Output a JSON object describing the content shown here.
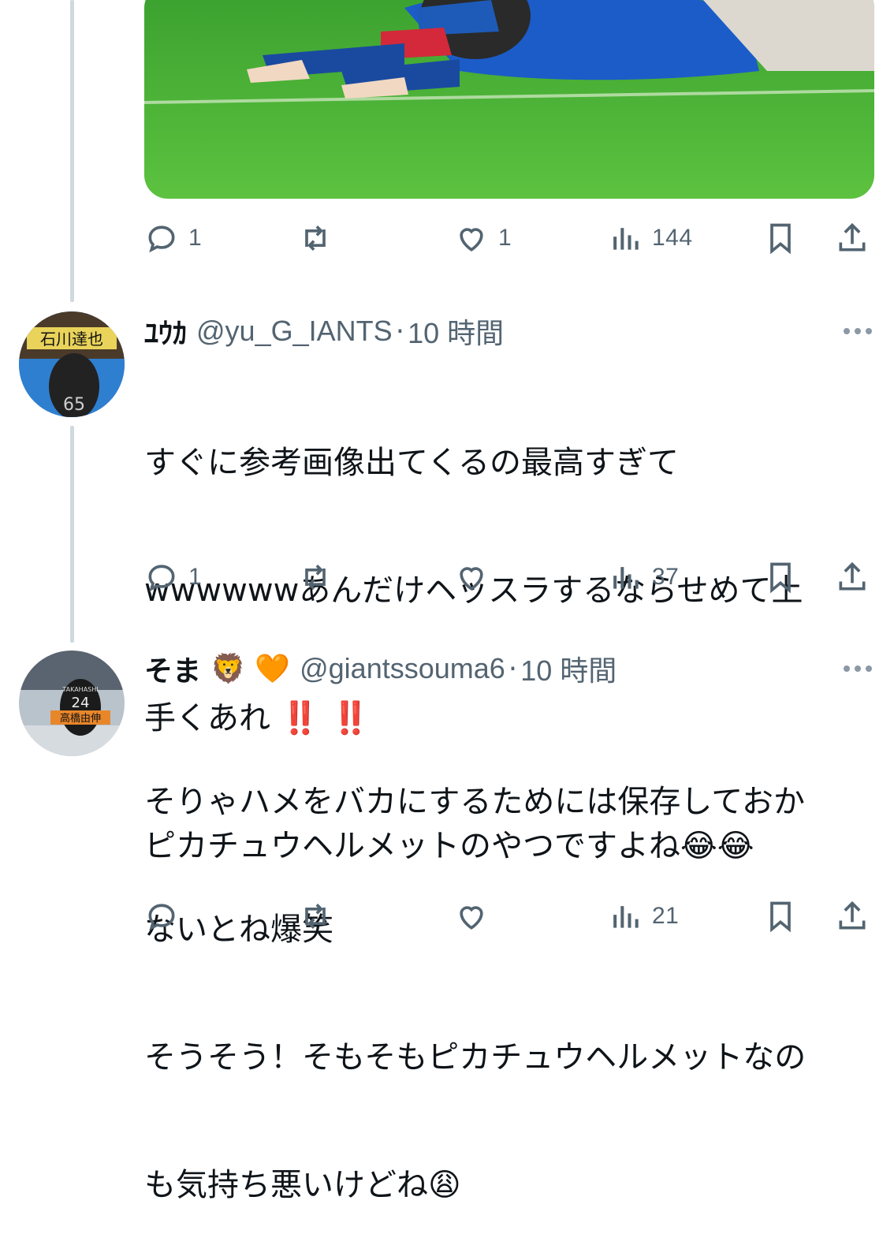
{
  "top_tweet": {
    "actions": {
      "replies": "1",
      "retweets": "",
      "likes": "1",
      "views": "144"
    }
  },
  "tweets": [
    {
      "name": "ﾕｳｶ",
      "handle": "@yu_G_IANTS",
      "separator": "·",
      "time": "10 時間",
      "text_line1": "すぐに参考画像出てくるの最高すぎて",
      "text_line2": "wwwwwwあんだけヘッスラするならせめて上",
      "text_line3": "手くあれ",
      "text_line3_emoji": "‼️ ‼️",
      "text_line4": "ピカチュウヘルメットのやつですよね",
      "text_line4_emoji": "😂😂",
      "avatar_text": "石川達也",
      "avatar_number": "65",
      "actions": {
        "replies": "1",
        "retweets": "",
        "likes": "",
        "views": "37"
      }
    },
    {
      "name": "そま",
      "name_emoji": "🦁 🧡",
      "handle": "@giantssouma6",
      "separator": "·",
      "time": "10 時間",
      "text_line1": "そりゃハメをバカにするためには保存しておか",
      "text_line2": "ないとね爆笑",
      "text_line3": "そうそう！そもそもピカチュウヘルメットなの",
      "text_line4": "も気持ち悪いけどね",
      "text_line4_emoji": "😩",
      "avatar_text": "高橋由伸",
      "avatar_number": "24",
      "avatar_jersey_name": "TAKAHASHI",
      "actions": {
        "replies": "",
        "retweets": "",
        "likes": "",
        "views": "21"
      }
    }
  ],
  "colors": {
    "text": "#0f1419",
    "muted": "#536471",
    "thread": "#cfd9de",
    "emphasis_red": "#e0245e"
  }
}
